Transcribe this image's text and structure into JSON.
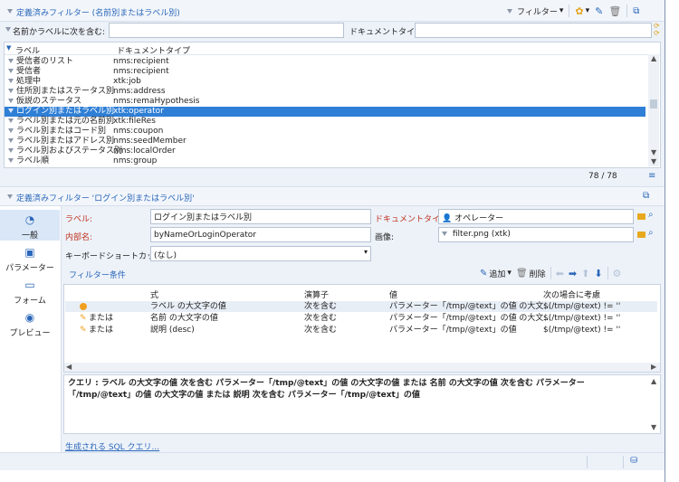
{
  "top_panel": {
    "title": "定義済みフィルター (名前別またはラベル別)",
    "filter_button": "フィルター",
    "label_filter_caption": "名前かラベルに次を含む:",
    "label_filter_value": "",
    "doctype_caption": "ドキュメントタイプ:",
    "doctype_value": "",
    "columns": {
      "label": "ラベル",
      "doctype": "ドキュメントタイプ"
    },
    "rows": [
      {
        "label": "受信者のリスト",
        "doctype": "nms:recipient",
        "selected": false
      },
      {
        "label": "受信者",
        "doctype": "nms:recipient",
        "selected": false
      },
      {
        "label": "処理中",
        "doctype": "xtk:job",
        "selected": false
      },
      {
        "label": "住所別またはステータス別",
        "doctype": "nms:address",
        "selected": false
      },
      {
        "label": "仮説のステータス",
        "doctype": "nms:remaHypothesis",
        "selected": false
      },
      {
        "label": "ログイン別またはラベル別",
        "doctype": "xtk:operator",
        "selected": true
      },
      {
        "label": "ラベル別または元の名前別",
        "doctype": "xtk:fileRes",
        "selected": false
      },
      {
        "label": "ラベル別またはコード別",
        "doctype": "nms:coupon",
        "selected": false
      },
      {
        "label": "ラベル別またはアドレス別",
        "doctype": "nms:seedMember",
        "selected": false
      },
      {
        "label": "ラベル別およびステータス別",
        "doctype": "nms:localOrder",
        "selected": false
      },
      {
        "label": "ラベル順",
        "doctype": "nms:group",
        "selected": false
      }
    ],
    "count": "78 / 78"
  },
  "detail_panel": {
    "title": "定義済みフィルター 'ログイン別またはラベル別'",
    "sidebar": [
      {
        "label": "一般",
        "active": true
      },
      {
        "label": "パラメーター",
        "active": false
      },
      {
        "label": "フォーム",
        "active": false
      },
      {
        "label": "プレビュー",
        "active": false
      }
    ],
    "form": {
      "label_caption": "ラベル:",
      "label_value": "ログイン別またはラベル別",
      "doctype_caption": "ドキュメントタイプ:",
      "doctype_value": "オペレーター",
      "internal_name_caption": "内部名:",
      "internal_name_value": "byNameOrLoginOperator",
      "image_caption": "画像:",
      "image_value": "filter.png (xtk)",
      "shortcut_caption": "キーボードショートカット:",
      "shortcut_value": "(なし)"
    },
    "conditions": {
      "title": "フィルター条件",
      "add_button": "追加",
      "delete_button": "削除",
      "columns": {
        "expression": "式",
        "operator": "演算子",
        "value": "値",
        "ignore_if": "次の場合に考慮"
      },
      "rows": [
        {
          "prefix": "",
          "expression": "ラベル の大文字の値",
          "operator": "次を含む",
          "value": "パラメーター「/tmp/@text」の値 の大文...",
          "ignore_if": "$(/tmp/@text) != ''"
        },
        {
          "prefix": "または",
          "expression": "名前 の大文字の値",
          "operator": "次を含む",
          "value": "パラメーター「/tmp/@text」の値 の大文...",
          "ignore_if": "$(/tmp/@text) != ''"
        },
        {
          "prefix": "または",
          "expression": "説明 (desc)",
          "operator": "次を含む",
          "value": "パラメーター「/tmp/@text」の値",
          "ignore_if": "$(/tmp/@text) != ''"
        }
      ]
    },
    "query_text": "クエリ : ラベル の大文字の値 次を含む パラメーター「/tmp/@text」の値 の大文字の値 または 名前 の大文字の値 次を含む パラメーター「/tmp/@text」の値 の大文字の値 または 説明 次を含む パラメーター「/tmp/@text」の値",
    "sql_link": "生成される SQL クエリ..."
  },
  "colors": {
    "accent": "#2a66b8",
    "selection": "#2f7fd6",
    "required": "#c0311d",
    "panel_bg": "#edf2f9"
  }
}
